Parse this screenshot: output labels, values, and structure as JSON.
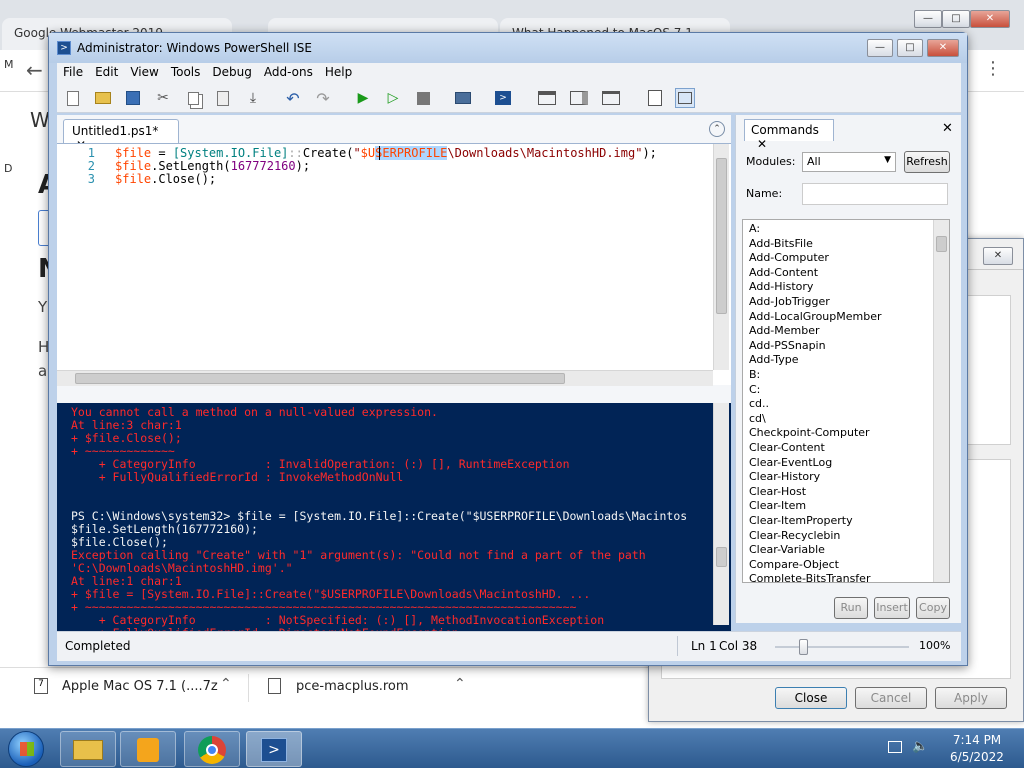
{
  "browser": {
    "tabs": [
      "Google Webmaster 2019...",
      "... ... ...",
      "What Happened to MacOS 7.1 ..."
    ],
    "left_letters": [
      "W",
      "A",
      "N",
      "Y",
      "H",
      "a"
    ],
    "downloads": [
      {
        "name": "Apple Mac OS 7.1 (....7z"
      },
      {
        "name": "pce-macplus.rom"
      }
    ]
  },
  "dialog": {
    "buttons": {
      "close": "Close",
      "cancel": "Cancel",
      "apply": "Apply"
    }
  },
  "ise": {
    "title": "Administrator: Windows PowerShell ISE",
    "menu": [
      "File",
      "Edit",
      "View",
      "Tools",
      "Debug",
      "Add-ons",
      "Help"
    ],
    "doc_tab": "Untitled1.ps1*",
    "editor_lines": [
      {
        "num": "1",
        "text": "$file = [System.IO.File]::Create(\"$USERPROFILE\\Downloads\\MacintoshHD.img\");"
      },
      {
        "num": "2",
        "text": "$file.SetLength(167772160);"
      },
      {
        "num": "3",
        "text": "$file.Close();"
      }
    ],
    "console_lines": [
      {
        "text": "You cannot call a method on a null-valued expression.",
        "cls": "err"
      },
      {
        "text": "At line:3 char:1",
        "cls": "err"
      },
      {
        "text": "+ $file.Close();",
        "cls": "err"
      },
      {
        "text": "+ ~~~~~~~~~~~~~",
        "cls": "err"
      },
      {
        "text": "    + CategoryInfo          : InvalidOperation: (:) [], RuntimeException",
        "cls": "err"
      },
      {
        "text": "    + FullyQualifiedErrorId : InvokeMethodOnNull",
        "cls": "err"
      },
      {
        "text": "",
        "cls": "ok"
      },
      {
        "text": "",
        "cls": "ok"
      },
      {
        "text": "PS C:\\Windows\\system32> $file = [System.IO.File]::Create(\"$USERPROFILE\\Downloads\\Macintos",
        "cls": "ok"
      },
      {
        "text": "$file.SetLength(167772160);",
        "cls": "ok"
      },
      {
        "text": "$file.Close();",
        "cls": "ok"
      },
      {
        "text": "Exception calling \"Create\" with \"1\" argument(s): \"Could not find a part of the path",
        "cls": "err"
      },
      {
        "text": "'C:\\Downloads\\MacintoshHD.img'.\"",
        "cls": "err"
      },
      {
        "text": "At line:1 char:1",
        "cls": "err"
      },
      {
        "text": "+ $file = [System.IO.File]::Create(\"$USERPROFILE\\Downloads\\MacintoshHD. ...",
        "cls": "err"
      },
      {
        "text": "+ ~~~~~~~~~~~~~~~~~~~~~~~~~~~~~~~~~~~~~~~~~~~~~~~~~~~~~~~~~~~~~~~~~~~~~~~",
        "cls": "err"
      },
      {
        "text": "    + CategoryInfo          : NotSpecified: (:) [], MethodInvocationException",
        "cls": "err"
      },
      {
        "text": "    + FullyQualifiedErrorId : DirectoryNotFoundException",
        "cls": "err"
      }
    ],
    "commands": {
      "tab": "Commands",
      "modules_label": "Modules:",
      "modules_value": "All",
      "refresh": "Refresh",
      "name_label": "Name:",
      "items": [
        "A:",
        "Add-BitsFile",
        "Add-Computer",
        "Add-Content",
        "Add-History",
        "Add-JobTrigger",
        "Add-LocalGroupMember",
        "Add-Member",
        "Add-PSSnapin",
        "Add-Type",
        "B:",
        "C:",
        "cd..",
        "cd\\",
        "Checkpoint-Computer",
        "Clear-Content",
        "Clear-EventLog",
        "Clear-History",
        "Clear-Host",
        "Clear-Item",
        "Clear-ItemProperty",
        "Clear-Recyclebin",
        "Clear-Variable",
        "Compare-Object",
        "Complete-BitsTransfer"
      ],
      "run": "Run",
      "insert": "Insert",
      "copy": "Copy"
    },
    "status": {
      "text": "Completed",
      "line": "Ln 1",
      "col": "Col 38",
      "zoom": "100%"
    }
  },
  "taskbar": {
    "time": "7:14 PM",
    "date": "6/5/2022"
  }
}
